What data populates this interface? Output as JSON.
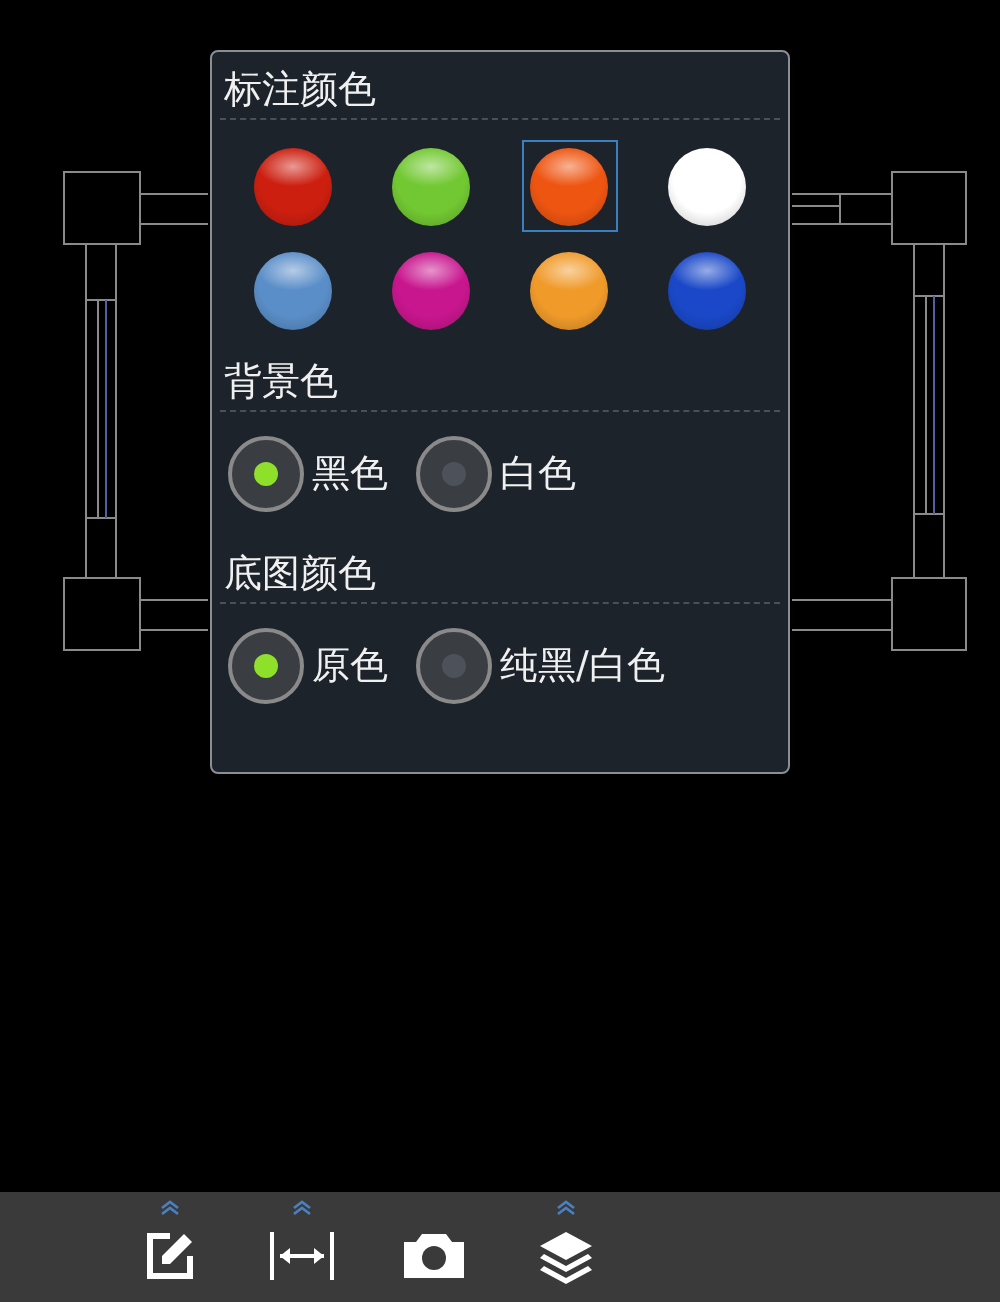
{
  "annotation_color": {
    "title": "标注颜色",
    "swatches": [
      {
        "color": "#cc1f10",
        "selected": false
      },
      {
        "color": "#72c832",
        "selected": false
      },
      {
        "color": "#ee5511",
        "selected": true
      },
      {
        "color": "#ffffff",
        "selected": false
      },
      {
        "color": "#5a8ec8",
        "selected": false
      },
      {
        "color": "#c8168e",
        "selected": false
      },
      {
        "color": "#f09a2a",
        "selected": false
      },
      {
        "color": "#1a48c8",
        "selected": false
      }
    ]
  },
  "background_color": {
    "title": "背景色",
    "options": [
      {
        "label": "黑色",
        "selected": true
      },
      {
        "label": "白色",
        "selected": false
      }
    ]
  },
  "base_map_color": {
    "title": "底图颜色",
    "options": [
      {
        "label": "原色",
        "selected": true
      },
      {
        "label": "纯黑/白色",
        "selected": false
      }
    ]
  },
  "toolbar": [
    {
      "kind": "edit",
      "expandable": true
    },
    {
      "kind": "measure",
      "expandable": true
    },
    {
      "kind": "camera",
      "expandable": false
    },
    {
      "kind": "layers",
      "expandable": true
    }
  ]
}
